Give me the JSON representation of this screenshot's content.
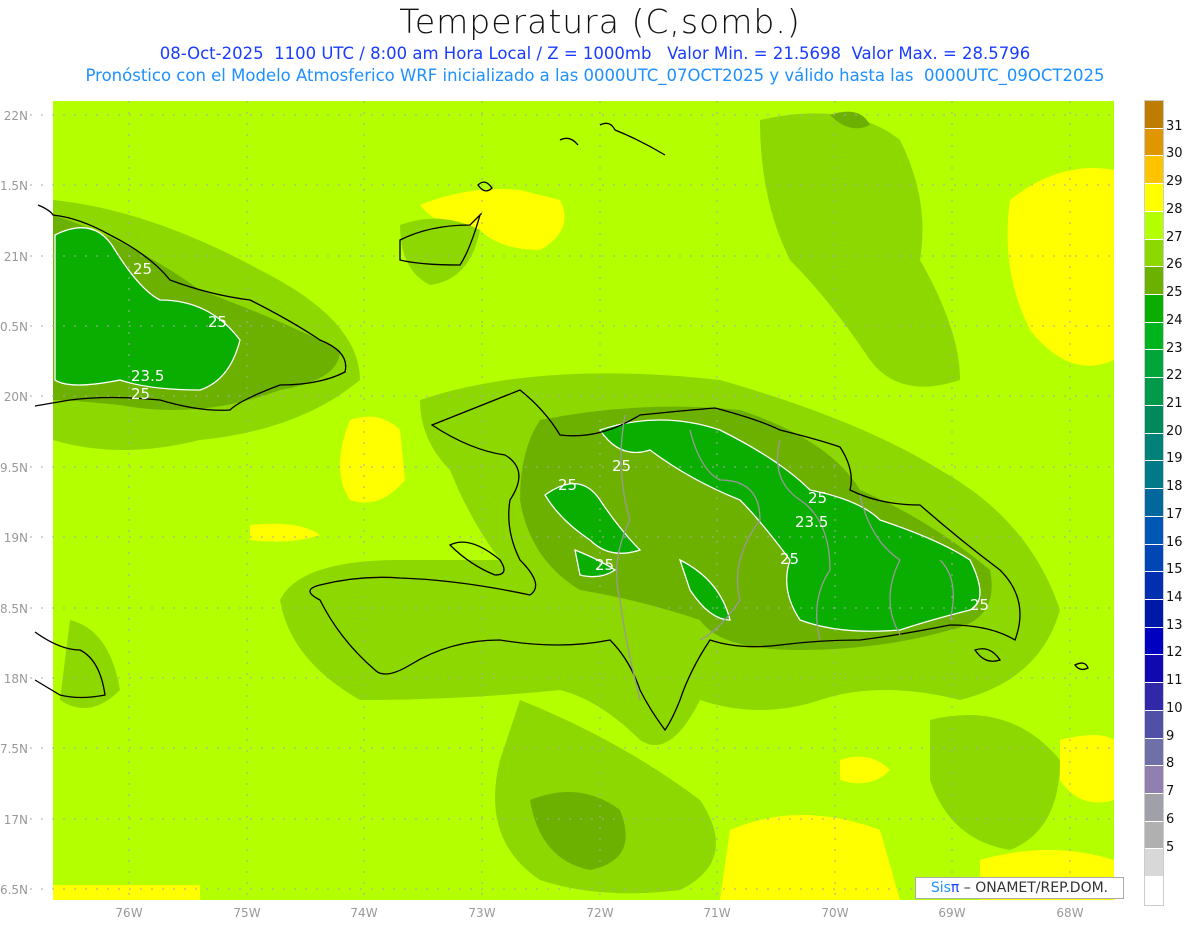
{
  "header": {
    "title": "Temperatura (C,somb.)",
    "line1": "08-Oct-2025  1100 UTC / 8:00 am Hora Local / Z = 1000mb   Valor Min. = 21.5698  Valor Max. = 28.5796",
    "line2": "Pronóstico con el Modelo Atmosferico WRF inicializado a las 0000UTC_07OCT2025 y válido hasta las  0000UTC_09OCT2025"
  },
  "axes": {
    "lat_labels": [
      "22N",
      "1.5N",
      "21N",
      "0.5N",
      "20N",
      "9.5N",
      "19N",
      "8.5N",
      "18N",
      "7.5N",
      "17N",
      "6.5N"
    ],
    "lon_labels": [
      "76W",
      "75W",
      "74W",
      "73W",
      "72W",
      "71W",
      "70W",
      "69W",
      "68W"
    ]
  },
  "contour_labels": [
    "25",
    "25",
    "23.5",
    "25",
    "25",
    "25",
    "25",
    "25",
    "23.5",
    "25",
    "25"
  ],
  "colorbar": {
    "labels": [
      "31",
      "30",
      "29",
      "28",
      "27",
      "26",
      "25",
      "24",
      "23",
      "22",
      "21",
      "20",
      "19",
      "18",
      "17",
      "16",
      "15",
      "14",
      "13",
      "12",
      "11",
      "10",
      "9",
      "8",
      "7",
      "6",
      "5"
    ],
    "colors": [
      "#c07c00",
      "#e09600",
      "#ffc400",
      "#ffff00",
      "#b4ff00",
      "#8cd800",
      "#6cb000",
      "#0aae00",
      "#00b41e",
      "#00a53a",
      "#009a4a",
      "#008a5c",
      "#008278",
      "#007a88",
      "#00689c",
      "#0058b4",
      "#0046b4",
      "#0030b0",
      "#0018a8",
      "#0000c0",
      "#1008b0",
      "#3028a8",
      "#5050a8",
      "#7070a8",
      "#9080b0",
      "#a0a0a8",
      "#b0b0b0",
      "#d8d8d8",
      "#ffffff"
    ]
  },
  "footer": {
    "brand_a": "Sis",
    "brand_b": "π",
    "text": " – ONAMET/REP.DOM."
  }
}
